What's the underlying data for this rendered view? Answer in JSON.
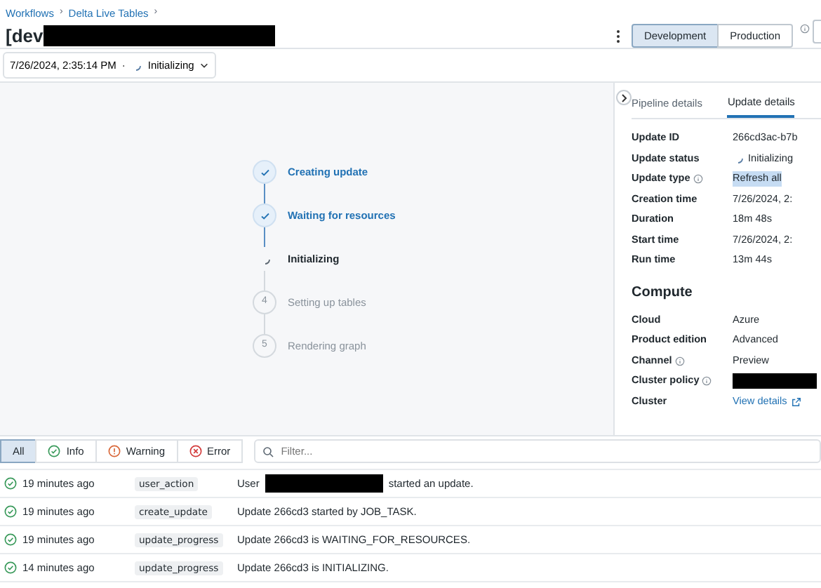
{
  "breadcrumbs": [
    {
      "label": "Workflows",
      "separator": "›"
    },
    {
      "label": "Delta Live Tables",
      "separator": "›"
    }
  ],
  "title": [
    {
      "kind": "text",
      "text": "[dev"
    },
    {
      "kind": "redacted"
    }
  ],
  "modes": [
    {
      "label": "Development",
      "selected": true
    },
    {
      "label": "Production",
      "selected": false
    }
  ],
  "update_selector": {
    "time": "7/26/2024, 2:35:14 PM",
    "separator": "·",
    "status": "Initializing"
  },
  "steps": [
    {
      "label": "Creating update",
      "kind": "done"
    },
    {
      "label": "Waiting for resources",
      "kind": "done"
    },
    {
      "label": "Initializing",
      "kind": "active"
    },
    {
      "label": "Setting up tables",
      "kind": "pending",
      "number": "4"
    },
    {
      "label": "Rendering graph",
      "kind": "pending",
      "number": "5"
    }
  ],
  "details_panel": {
    "tabs": [
      {
        "label": "Pipeline details",
        "selected": false
      },
      {
        "label": "Update details",
        "selected": true
      }
    ],
    "update_rows": [
      {
        "label": "Update ID",
        "value": "266cd3ac-b7b"
      },
      {
        "label": "Update status",
        "value": "Initializing",
        "kind": "status"
      },
      {
        "label": "Update type",
        "value": "Refresh all",
        "info": true,
        "kind": "highlight"
      },
      {
        "label": "Creation time",
        "value": "7/26/2024, 2:"
      },
      {
        "label": "Duration",
        "value": "18m 48s"
      },
      {
        "label": "Start time",
        "value": "7/26/2024, 2:"
      },
      {
        "label": "Run time",
        "value": "13m 44s"
      }
    ],
    "compute_title": "Compute",
    "compute_rows": [
      {
        "label": "Cloud",
        "value": "Azure"
      },
      {
        "label": "Product edition",
        "value": "Advanced"
      },
      {
        "label": "Channel",
        "value": "Preview",
        "info": true
      },
      {
        "label": "Cluster policy",
        "info": true,
        "kind": "redacted"
      },
      {
        "label": "Cluster",
        "value": "View details",
        "kind": "link"
      }
    ]
  },
  "level_filters": [
    {
      "label": "All",
      "kind": "all",
      "selected": true
    },
    {
      "label": "Info",
      "kind": "info",
      "selected": false
    },
    {
      "label": "Warning",
      "kind": "warning",
      "selected": false
    },
    {
      "label": "Error",
      "kind": "error",
      "selected": false
    }
  ],
  "filter": {
    "placeholder": "Filter..."
  },
  "events": [
    {
      "time": "19 minutes ago",
      "type": "user_action",
      "message": [
        {
          "kind": "text",
          "text": "User"
        },
        {
          "kind": "redacted"
        },
        {
          "kind": "text",
          "text": "started an update."
        }
      ]
    },
    {
      "time": "19 minutes ago",
      "type": "create_update",
      "message": [
        {
          "kind": "text",
          "text": "Update 266cd3 started by JOB_TASK."
        }
      ]
    },
    {
      "time": "19 minutes ago",
      "type": "update_progress",
      "message": [
        {
          "kind": "text",
          "text": "Update 266cd3 is WAITING_FOR_RESOURCES."
        }
      ]
    },
    {
      "time": "14 minutes ago",
      "type": "update_progress",
      "message": [
        {
          "kind": "text",
          "text": "Update 266cd3 is INITIALIZING."
        }
      ]
    }
  ]
}
